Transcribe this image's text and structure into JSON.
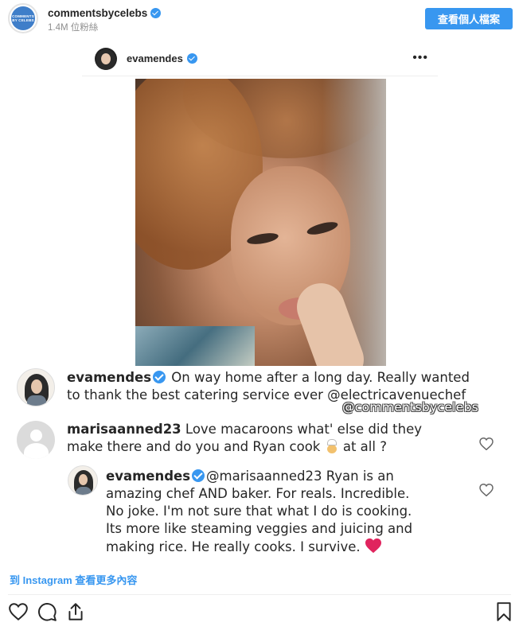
{
  "header": {
    "avatar_text": [
      "COMMENTS",
      "BY CELEBS"
    ],
    "username": "commentsbycelebs",
    "followers": "1.4M 位粉絲",
    "view_profile_label": "查看個人檔案"
  },
  "post": {
    "inner_username": "evamendes",
    "more_label": "•••",
    "comments": [
      {
        "username": "evamendes",
        "text_1": "On way home after a long day. Really wanted",
        "text_2": "to thank the best catering service ever",
        "mention": "@electricavenuechef"
      },
      {
        "username": "marisaanned23",
        "text_1": "Love macaroons what' else did they",
        "text_2_a": "make there and do you and Ryan cook",
        "text_2_b": "at all ?"
      },
      {
        "username": "evamendes",
        "mention": "@marisaanned23",
        "text_1_after": "Ryan is an",
        "text_2": "amazing chef AND baker. For reals. Incredible.",
        "text_3": "No joke. I'm not sure that what I do is cooking.",
        "text_4": "Its more like steaming veggies and juicing and",
        "text_5": "making rice. He really cooks. I survive."
      }
    ],
    "watermark": "@commentsbycelebs"
  },
  "footer": {
    "more_link": "到 Instagram 查看更多內容"
  },
  "icons": [
    "heart-icon",
    "comment-icon",
    "share-icon",
    "bookmark-icon"
  ],
  "colors": {
    "accent": "#3897f0",
    "verified": "#3897f0",
    "heart": "#e0245e"
  }
}
